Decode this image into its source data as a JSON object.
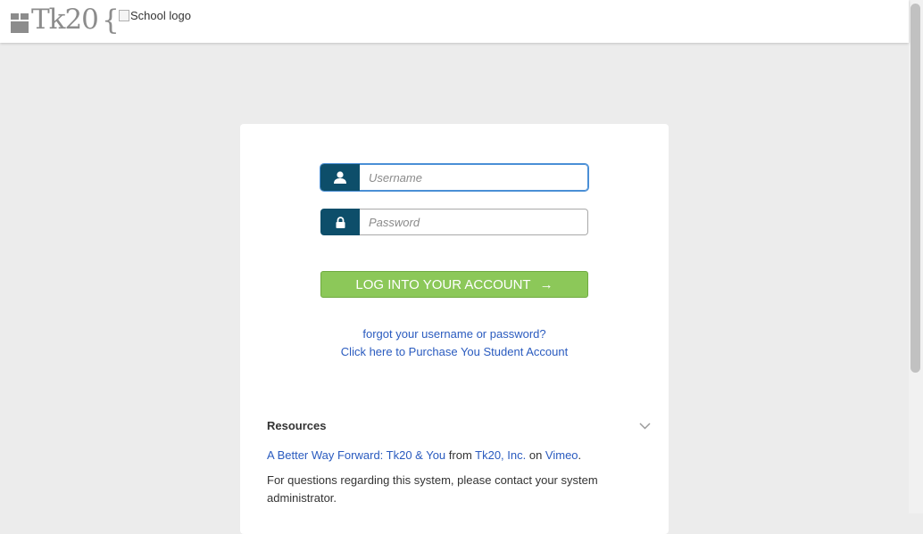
{
  "header": {
    "logo_text": "Tk20",
    "logo_brace": "{",
    "school_logo_alt": "School logo"
  },
  "login": {
    "username_placeholder": "Username",
    "password_placeholder": "Password",
    "submit_label": "LOG INTO YOUR ACCOUNT",
    "submit_arrow": "→",
    "forgot_link": "forgot your username or password?",
    "purchase_link": "Click here to Purchase You Student Account"
  },
  "resources": {
    "title": "Resources",
    "video_link": "A Better Way Forward: Tk20 & You",
    "from_text": " from ",
    "company_link": "Tk20, Inc.",
    "on_text": " on ",
    "host_link": "Vimeo",
    "period": ".",
    "contact_text": "For questions regarding this system, please contact your system administrator."
  },
  "colors": {
    "addon": "#0d4e6a",
    "login_button": "#8cc859",
    "link": "#2a5bbf",
    "background": "#ececec"
  },
  "icons": {
    "user": "user-icon",
    "lock": "lock-icon",
    "chevron": "chevron-down-icon"
  }
}
